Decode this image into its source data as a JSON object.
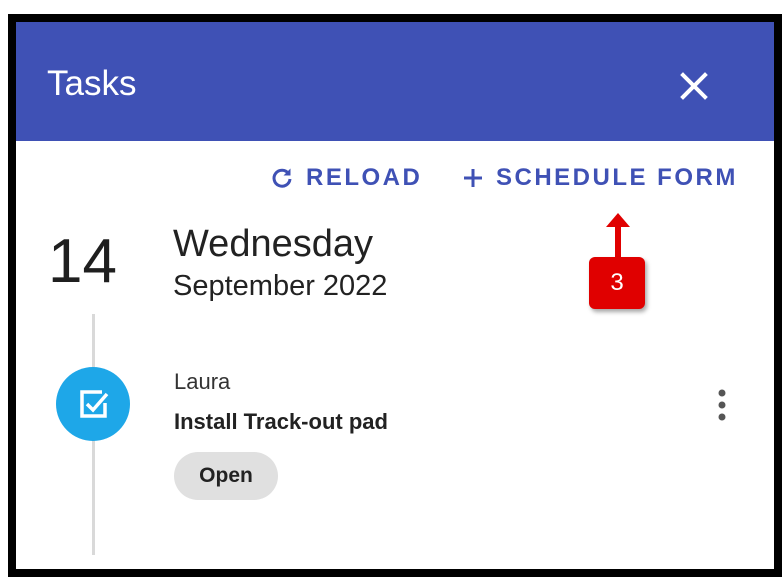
{
  "header": {
    "title": "Tasks",
    "close_icon": "close-icon",
    "background_color": "#3f51b5"
  },
  "toolbar": {
    "reload_label": "RELOAD",
    "reload_icon": "refresh-icon",
    "schedule_label": "SCHEDULE FORM",
    "schedule_icon": "plus-icon",
    "accent_color": "#3f51b5"
  },
  "date": {
    "day": "14",
    "weekday": "Wednesday",
    "month_year": "September 2022"
  },
  "task": {
    "assignee": "Laura",
    "title": "Install Track-out pad",
    "status": "Open",
    "icon": "checkbox-checked-icon",
    "icon_color": "#1ea7e8",
    "menu_icon": "more-vertical-icon"
  },
  "annotation": {
    "number": "3",
    "color": "#e00000"
  }
}
